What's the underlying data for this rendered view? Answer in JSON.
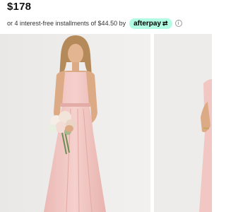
{
  "product": {
    "price": "$178",
    "installments_text": "or 4 interest-free installments of $44.50 by",
    "afterpay_label": "afterpay",
    "afterpay_icon": "afterpay-arrows-icon",
    "info_icon": "info-icon"
  },
  "gallery": {
    "images": [
      {
        "name": "model-in-blush-halter-maxi-dress",
        "selected": true
      },
      {
        "name": "model-in-blush-dress-alternate-view",
        "selected": false
      }
    ]
  },
  "colors": {
    "background": "#ffffff",
    "photo_backdrop": "#eeedeb",
    "dress_blush": "#f2c7c3",
    "afterpay_mint": "#b2fce4"
  }
}
